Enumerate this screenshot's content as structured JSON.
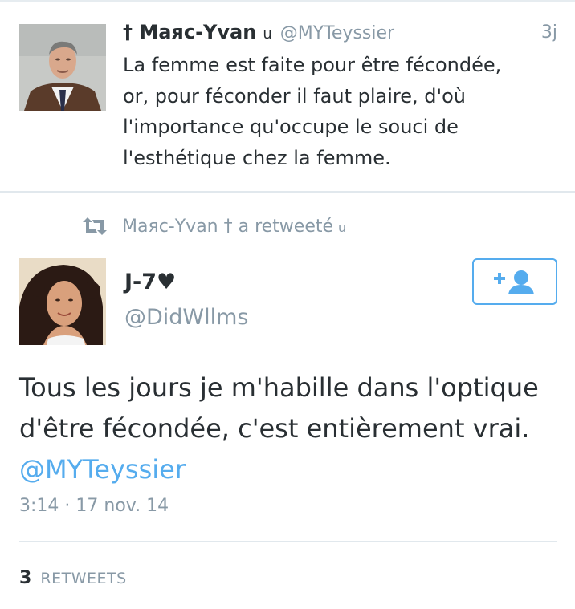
{
  "tweet1": {
    "name": "† Маяс-Yvan",
    "name_suffix": "ս",
    "handle": "@MYTeyssier",
    "time": "3j",
    "text": "La femme est faite pour être fécondée,\nor, pour féconder il faut plaire, d'où\nl'importance qu'occupe le souci de\nl'esthétique chez la femme."
  },
  "retweet_context": {
    "label": "Маяс-Yvan † a retweeté",
    "suffix": "ս"
  },
  "tweet2": {
    "name": "J-7♥",
    "handle": "@DidWllms",
    "text": "Tous les jours je m'habille dans l'optique d'être fécondée, c'est entièrement vrai.",
    "mention": "@MYTeyssier",
    "time": "3:14",
    "separator": "·",
    "date": "17 nov. 14",
    "retweet_count": "3",
    "retweet_label": "RETWEETS"
  },
  "colors": {
    "accent": "#55acee",
    "secondary_text": "#8899a6",
    "primary_text": "#292f33",
    "divider": "#e1e8ed"
  },
  "icons": {
    "retweet": "retweet-icon",
    "follow": "add-user-icon"
  }
}
